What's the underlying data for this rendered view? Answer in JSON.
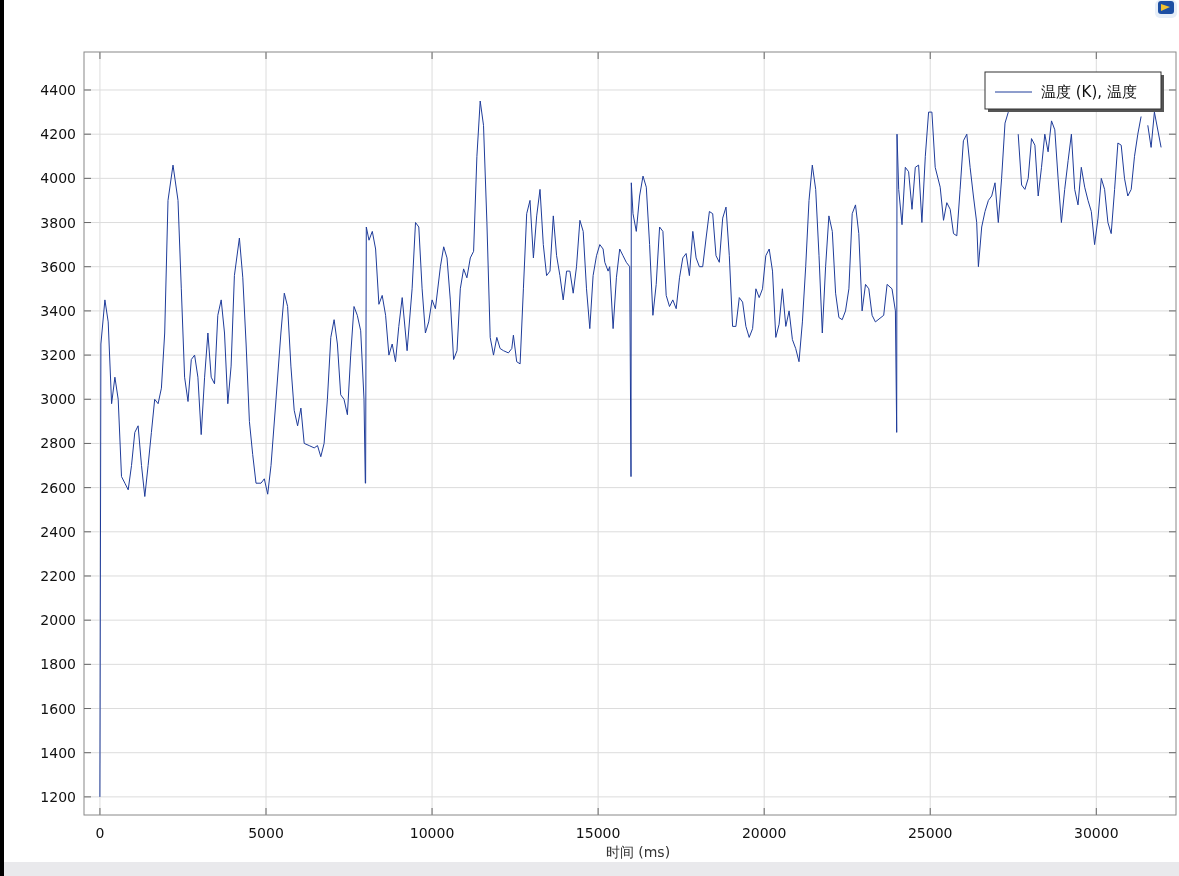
{
  "plot": {
    "chart_data": {
      "type": "line",
      "xlabel": "时间 (ms)",
      "x": [
        0,
        30,
        150,
        250,
        350,
        450,
        550,
        650,
        750,
        850,
        950,
        1050,
        1150,
        1250,
        1350,
        1450,
        1550,
        1650,
        1750,
        1850,
        1950,
        2050,
        2200,
        2350,
        2450,
        2550,
        2650,
        2750,
        2850,
        2950,
        3050,
        3150,
        3250,
        3350,
        3450,
        3550,
        3650,
        3750,
        3850,
        3950,
        4050,
        4200,
        4300,
        4400,
        4500,
        4600,
        4700,
        4850,
        4950,
        5050,
        5150,
        5300,
        5450,
        5550,
        5650,
        5750,
        5850,
        5950,
        6050,
        6150,
        6300,
        6450,
        6550,
        6650,
        6750,
        6850,
        6950,
        7050,
        7150,
        7250,
        7350,
        7450,
        7550,
        7650,
        7750,
        7850,
        7950,
        7990,
        8000,
        8020,
        8100,
        8200,
        8300,
        8400,
        8500,
        8600,
        8700,
        8800,
        8900,
        9000,
        9100,
        9250,
        9400,
        9500,
        9600,
        9700,
        9800,
        9900,
        10000,
        10100,
        10250,
        10350,
        10450,
        10550,
        10650,
        10750,
        10850,
        10950,
        11050,
        11150,
        11250,
        11350,
        11450,
        11550,
        11650,
        11750,
        11850,
        11950,
        12050,
        12150,
        12300,
        12400,
        12450,
        12550,
        12650,
        12750,
        12850,
        12950,
        13050,
        13150,
        13250,
        13350,
        13450,
        13550,
        13650,
        13750,
        13850,
        13950,
        14050,
        14150,
        14250,
        14350,
        14450,
        14550,
        14650,
        14750,
        14850,
        14950,
        15050,
        15150,
        15200,
        15300,
        15350,
        15450,
        15550,
        15650,
        15750,
        15850,
        15950,
        15990,
        16000,
        16050,
        16150,
        16250,
        16350,
        16450,
        16550,
        16650,
        16750,
        16850,
        16950,
        17050,
        17150,
        17250,
        17350,
        17450,
        17550,
        17650,
        17750,
        17850,
        17950,
        18050,
        18150,
        18250,
        18350,
        18450,
        18550,
        18650,
        18750,
        18850,
        18950,
        19050,
        19150,
        19250,
        19350,
        19450,
        19550,
        19650,
        19750,
        19850,
        19950,
        20050,
        20150,
        20250,
        20350,
        20450,
        20550,
        20650,
        20750,
        20850,
        20950,
        21050,
        21150,
        21250,
        21350,
        21450,
        21550,
        21650,
        21750,
        21850,
        21950,
        22050,
        22150,
        22250,
        22350,
        22450,
        22550,
        22650,
        22750,
        22850,
        22950,
        23050,
        23150,
        23250,
        23350,
        23600,
        23700,
        23850,
        23950,
        23990,
        24000,
        24050,
        24150,
        24250,
        24350,
        24450,
        24550,
        24650,
        24750,
        24850,
        24950,
        25050,
        25150,
        25300,
        25400,
        25500,
        25600,
        25700,
        25800,
        25900,
        26000,
        26100,
        26200,
        26300,
        26400,
        26450,
        26550,
        26650,
        26750,
        26850,
        26950,
        27050,
        27150,
        27250,
        27350,
        27450,
        27550,
        27650,
        27750,
        27850,
        27950,
        28050,
        28150,
        28250,
        28350,
        28450,
        28550,
        28650,
        28750,
        28850,
        28950,
        29050,
        29150,
        29250,
        29350,
        29450,
        29550,
        29650,
        29750,
        29850,
        29950,
        30050,
        30150,
        30250,
        30350,
        30450,
        30550,
        30650,
        30750,
        30850,
        30950,
        31050,
        31150,
        31250,
        31350,
        31450,
        31550,
        31650,
        31750,
        31950
      ],
      "series": [
        {
          "name": "温度 (K), 温度",
          "color": "#1f3c9a",
          "values": [
            1200,
            3250,
            3450,
            3350,
            2980,
            3100,
            3000,
            2650,
            2620,
            2590,
            2700,
            2850,
            2880,
            2700,
            2560,
            2700,
            2850,
            3000,
            2980,
            3050,
            3300,
            3900,
            4060,
            3900,
            3500,
            3100,
            2990,
            3180,
            3200,
            3100,
            2840,
            3100,
            3300,
            3100,
            3070,
            3380,
            3450,
            3300,
            2980,
            3150,
            3560,
            3730,
            3550,
            3250,
            2900,
            2750,
            2620,
            2620,
            2640,
            2570,
            2700,
            3000,
            3300,
            3480,
            3420,
            3150,
            2950,
            2880,
            2960,
            2800,
            2790,
            2780,
            2790,
            2740,
            2800,
            3000,
            3280,
            3360,
            3250,
            3020,
            3000,
            2930,
            3200,
            3420,
            3380,
            3310,
            3000,
            2620,
            2620,
            3780,
            3720,
            3760,
            3680,
            3430,
            3470,
            3380,
            3200,
            3250,
            3170,
            3330,
            3460,
            3220,
            3500,
            3800,
            3780,
            3500,
            3300,
            3350,
            3450,
            3410,
            3600,
            3690,
            3640,
            3450,
            3180,
            3220,
            3500,
            3590,
            3550,
            3640,
            3670,
            4100,
            4350,
            4240,
            3800,
            3280,
            3200,
            3280,
            3230,
            3220,
            3210,
            3230,
            3290,
            3170,
            3160,
            3500,
            3840,
            3900,
            3640,
            3830,
            3950,
            3700,
            3560,
            3580,
            3830,
            3650,
            3560,
            3450,
            3580,
            3580,
            3480,
            3600,
            3810,
            3760,
            3500,
            3320,
            3560,
            3650,
            3700,
            3680,
            3620,
            3580,
            3600,
            3320,
            3550,
            3680,
            3650,
            3620,
            3600,
            2650,
            3980,
            3840,
            3760,
            3920,
            4010,
            3960,
            3700,
            3380,
            3520,
            3780,
            3760,
            3470,
            3420,
            3450,
            3410,
            3550,
            3640,
            3660,
            3560,
            3760,
            3640,
            3600,
            3600,
            3730,
            3850,
            3840,
            3650,
            3620,
            3820,
            3870,
            3650,
            3330,
            3330,
            3460,
            3440,
            3330,
            3280,
            3320,
            3500,
            3460,
            3500,
            3650,
            3680,
            3580,
            3280,
            3340,
            3500,
            3330,
            3400,
            3270,
            3230,
            3170,
            3350,
            3600,
            3900,
            4060,
            3950,
            3650,
            3300,
            3600,
            3830,
            3760,
            3480,
            3370,
            3360,
            3400,
            3500,
            3840,
            3880,
            3750,
            3400,
            3520,
            3500,
            3380,
            3350,
            3380,
            3520,
            3500,
            3400,
            2850,
            4200,
            3950,
            3790,
            4050,
            4030,
            3860,
            4050,
            4060,
            3800,
            4100,
            4300,
            4300,
            4050,
            3960,
            3810,
            3890,
            3860,
            3750,
            3740,
            3950,
            4170,
            4200,
            4050,
            3920,
            3800,
            3600,
            3780,
            3850,
            3900,
            3920,
            3980,
            3800,
            4000,
            4250,
            4300,
            null,
            null,
            4200,
            3970,
            3950,
            4000,
            4180,
            4150,
            3920,
            4050,
            4200,
            4120,
            4260,
            4220,
            4000,
            3800,
            3950,
            4080,
            4200,
            3950,
            3880,
            4050,
            3960,
            3900,
            3850,
            3700,
            3820,
            4000,
            3950,
            3800,
            3750,
            3950,
            4160,
            4150,
            4000,
            3920,
            3950,
            4100,
            4200,
            4280,
            null,
            4240,
            4140,
            4300,
            4140
          ]
        }
      ],
      "grid": true,
      "xlim": [
        -480,
        32400
      ],
      "ylim": [
        1118,
        4572
      ],
      "xticks": [
        0,
        5000,
        10000,
        15000,
        20000,
        25000,
        30000
      ],
      "yticks": [
        1200,
        1400,
        1600,
        1800,
        2000,
        2200,
        2400,
        2600,
        2800,
        3000,
        3200,
        3400,
        3600,
        3800,
        4000,
        4200,
        4400
      ]
    }
  }
}
